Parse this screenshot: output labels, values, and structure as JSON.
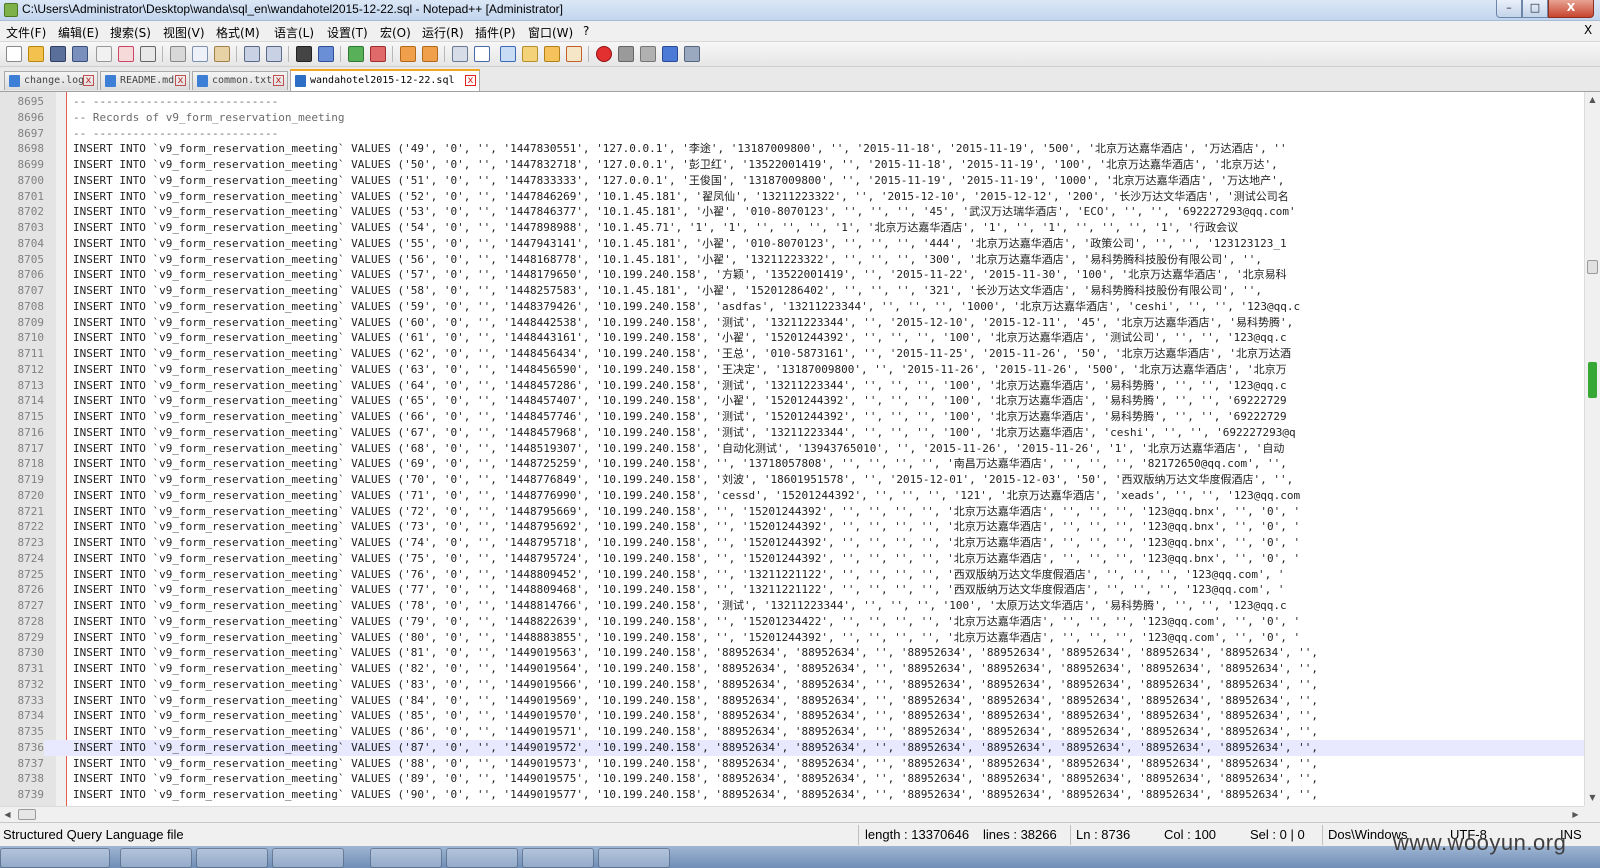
{
  "window": {
    "title": "C:\\Users\\Administrator\\Desktop\\wanda\\sql_en\\wandahotel2015-12-22.sql - Notepad++ [Administrator]",
    "min_label": "–",
    "max_label": "□",
    "close_label": "X"
  },
  "menu": {
    "items": [
      "文件(F)",
      "编辑(E)",
      "搜索(S)",
      "视图(V)",
      "格式(M)",
      "语言(L)",
      "设置(T)",
      "宏(O)",
      "运行(R)",
      "插件(P)",
      "窗口(W)",
      "?"
    ],
    "close_label": "X"
  },
  "tabs": [
    {
      "label": "change.log",
      "close": "x",
      "active": false
    },
    {
      "label": "README.md",
      "close": "x",
      "active": false
    },
    {
      "label": "common.txt",
      "close": "x",
      "active": false
    },
    {
      "label": "wandahotel2015-12-22.sql",
      "close": "x",
      "active": true
    }
  ],
  "editor": {
    "current_line": "8736",
    "lines": [
      {
        "n": "8695",
        "t": "-- ----------------------------"
      },
      {
        "n": "8696",
        "t": "-- Records of v9_form_reservation_meeting"
      },
      {
        "n": "8697",
        "t": "-- ----------------------------"
      },
      {
        "n": "8698",
        "t": "INSERT INTO `v9_form_reservation_meeting` VALUES ('49', '0', '', '1447830551', '127.0.0.1', '李途', '13187009800', '', '2015-11-18', '2015-11-19', '500', '北京万达嘉华酒店', '万达酒店', ''"
      },
      {
        "n": "8699",
        "t": "INSERT INTO `v9_form_reservation_meeting` VALUES ('50', '0', '', '1447832718', '127.0.0.1', '彭卫红', '13522001419', '', '2015-11-18', '2015-11-19', '100', '北京万达嘉华酒店', '北京万达',"
      },
      {
        "n": "8700",
        "t": "INSERT INTO `v9_form_reservation_meeting` VALUES ('51', '0', '', '1447833333', '127.0.0.1', '王俊国', '13187009800', '', '2015-11-19', '2015-11-19', '1000', '北京万达嘉华酒店', '万达地产',"
      },
      {
        "n": "8701",
        "t": "INSERT INTO `v9_form_reservation_meeting` VALUES ('52', '0', '', '1447846269', '10.1.45.181', '翟凤仙', '13211223322', '', '2015-12-10', '2015-12-12', '200', '长沙万达文华酒店', '测试公司名"
      },
      {
        "n": "8702",
        "t": "INSERT INTO `v9_form_reservation_meeting` VALUES ('53', '0', '', '1447846377', '10.1.45.181', '小翟', '010-8070123', '', '', '', '45', '武汉万达瑞华酒店', 'ECO', '', '', '692227293@qq.com'"
      },
      {
        "n": "8703",
        "t": "INSERT INTO `v9_form_reservation_meeting` VALUES ('54', '0', '', '1447898988', '10.1.45.71', '1', '1', '', '', '', '1', '北京万达嘉华酒店', '1', '', '1', '', '', '', '1', '行政会议"
      },
      {
        "n": "8704",
        "t": "INSERT INTO `v9_form_reservation_meeting` VALUES ('55', '0', '', '1447943141', '10.1.45.181', '小翟', '010-8070123', '', '', '', '444', '北京万达嘉华酒店', '政策公司', '', '', '123123123_1"
      },
      {
        "n": "8705",
        "t": "INSERT INTO `v9_form_reservation_meeting` VALUES ('56', '0', '', '1448168778', '10.1.45.181', '小翟', '13211223322', '', '', '', '300', '北京万达嘉华酒店', '易科势腾科技股份有限公司', '',"
      },
      {
        "n": "8706",
        "t": "INSERT INTO `v9_form_reservation_meeting` VALUES ('57', '0', '', '1448179650', '10.199.240.158', '方颖', '13522001419', '', '2015-11-22', '2015-11-30', '100', '北京万达嘉华酒店', '北京易科"
      },
      {
        "n": "8707",
        "t": "INSERT INTO `v9_form_reservation_meeting` VALUES ('58', '0', '', '1448257583', '10.1.45.181', '小翟', '15201286402', '', '', '', '321', '长沙万达文华酒店', '易科势腾科技股份有限公司', '',"
      },
      {
        "n": "8708",
        "t": "INSERT INTO `v9_form_reservation_meeting` VALUES ('59', '0', '', '1448379426', '10.199.240.158', 'asdfas', '13211223344', '', '', '', '1000', '北京万达嘉华酒店', 'ceshi', '', '', '123@qq.c"
      },
      {
        "n": "8709",
        "t": "INSERT INTO `v9_form_reservation_meeting` VALUES ('60', '0', '', '1448442538', '10.199.240.158', '测试', '13211223344', '', '2015-12-10', '2015-12-11', '45', '北京万达嘉华酒店', '易科势腾',"
      },
      {
        "n": "8710",
        "t": "INSERT INTO `v9_form_reservation_meeting` VALUES ('61', '0', '', '1448443161', '10.199.240.158', '小翟', '15201244392', '', '', '', '100', '北京万达嘉华酒店', '测试公司', '', '', '123@qq.c"
      },
      {
        "n": "8711",
        "t": "INSERT INTO `v9_form_reservation_meeting` VALUES ('62', '0', '', '1448456434', '10.199.240.158', '王总', '010-5873161', '', '2015-11-25', '2015-11-26', '50', '北京万达嘉华酒店', '北京万达酒"
      },
      {
        "n": "8712",
        "t": "INSERT INTO `v9_form_reservation_meeting` VALUES ('63', '0', '', '1448456590', '10.199.240.158', '王决定', '13187009800', '', '2015-11-26', '2015-11-26', '500', '北京万达嘉华酒店', '北京万"
      },
      {
        "n": "8713",
        "t": "INSERT INTO `v9_form_reservation_meeting` VALUES ('64', '0', '', '1448457286', '10.199.240.158', '测试', '13211223344', '', '', '', '100', '北京万达嘉华酒店', '易科势腾', '', '', '123@qq.c"
      },
      {
        "n": "8714",
        "t": "INSERT INTO `v9_form_reservation_meeting` VALUES ('65', '0', '', '1448457407', '10.199.240.158', '小翟', '15201244392', '', '', '', '100', '北京万达嘉华酒店', '易科势腾', '', '', '69222729"
      },
      {
        "n": "8715",
        "t": "INSERT INTO `v9_form_reservation_meeting` VALUES ('66', '0', '', '1448457746', '10.199.240.158', '测试', '15201244392', '', '', '', '100', '北京万达嘉华酒店', '易科势腾', '', '', '69222729"
      },
      {
        "n": "8716",
        "t": "INSERT INTO `v9_form_reservation_meeting` VALUES ('67', '0', '', '1448457968', '10.199.240.158', '测试', '13211223344', '', '', '', '100', '北京万达嘉华酒店', 'ceshi', '', '', '692227293@q"
      },
      {
        "n": "8717",
        "t": "INSERT INTO `v9_form_reservation_meeting` VALUES ('68', '0', '', '1448519307', '10.199.240.158', '自动化测试', '13943765010', '', '2015-11-26', '2015-11-26', '1', '北京万达嘉华酒店', '自动"
      },
      {
        "n": "8718",
        "t": "INSERT INTO `v9_form_reservation_meeting` VALUES ('69', '0', '', '1448725259', '10.199.240.158', '', '13718057808', '', '', '', '', '南昌万达嘉华酒店', '', '', '', '82172650@qq.com', '',"
      },
      {
        "n": "8719",
        "t": "INSERT INTO `v9_form_reservation_meeting` VALUES ('70', '0', '', '1448776849', '10.199.240.158', '刘波', '18601951578', '', '2015-12-01', '2015-12-03', '50', '西双版纳万达文华度假酒店', '',"
      },
      {
        "n": "8720",
        "t": "INSERT INTO `v9_form_reservation_meeting` VALUES ('71', '0', '', '1448776990', '10.199.240.158', 'cessd', '15201244392', '', '', '', '121', '北京万达嘉华酒店', 'xeads', '', '', '123@qq.com"
      },
      {
        "n": "8721",
        "t": "INSERT INTO `v9_form_reservation_meeting` VALUES ('72', '0', '', '1448795669', '10.199.240.158', '', '15201244392', '', '', '', '', '北京万达嘉华酒店', '', '', '', '123@qq.bnx', '', '0', '"
      },
      {
        "n": "8722",
        "t": "INSERT INTO `v9_form_reservation_meeting` VALUES ('73', '0', '', '1448795692', '10.199.240.158', '', '15201244392', '', '', '', '', '北京万达嘉华酒店', '', '', '', '123@qq.bnx', '', '0', '"
      },
      {
        "n": "8723",
        "t": "INSERT INTO `v9_form_reservation_meeting` VALUES ('74', '0', '', '1448795718', '10.199.240.158', '', '15201244392', '', '', '', '', '北京万达嘉华酒店', '', '', '', '123@qq.bnx', '', '0', '"
      },
      {
        "n": "8724",
        "t": "INSERT INTO `v9_form_reservation_meeting` VALUES ('75', '0', '', '1448795724', '10.199.240.158', '', '15201244392', '', '', '', '', '北京万达嘉华酒店', '', '', '', '123@qq.bnx', '', '0', '"
      },
      {
        "n": "8725",
        "t": "INSERT INTO `v9_form_reservation_meeting` VALUES ('76', '0', '', '1448809452', '10.199.240.158', '', '13211221122', '', '', '', '', '西双版纳万达文华度假酒店', '', '', '', '123@qq.com', '"
      },
      {
        "n": "8726",
        "t": "INSERT INTO `v9_form_reservation_meeting` VALUES ('77', '0', '', '1448809468', '10.199.240.158', '', '13211221122', '', '', '', '', '西双版纳万达文华度假酒店', '', '', '', '123@qq.com', '"
      },
      {
        "n": "8727",
        "t": "INSERT INTO `v9_form_reservation_meeting` VALUES ('78', '0', '', '1448814766', '10.199.240.158', '测试', '13211223344', '', '', '', '100', '太原万达文华酒店', '易科势腾', '', '', '123@qq.c"
      },
      {
        "n": "8728",
        "t": "INSERT INTO `v9_form_reservation_meeting` VALUES ('79', '0', '', '1448822639', '10.199.240.158', '', '15201234422', '', '', '', '', '北京万达嘉华酒店', '', '', '', '123@qq.com', '', '0', '"
      },
      {
        "n": "8729",
        "t": "INSERT INTO `v9_form_reservation_meeting` VALUES ('80', '0', '', '1448883855', '10.199.240.158', '', '15201244392', '', '', '', '', '北京万达嘉华酒店', '', '', '', '123@qq.com', '', '0', '"
      },
      {
        "n": "8730",
        "t": "INSERT INTO `v9_form_reservation_meeting` VALUES ('81', '0', '', '1449019563', '10.199.240.158', '88952634', '88952634', '', '88952634', '88952634', '88952634', '88952634', '88952634', '',"
      },
      {
        "n": "8731",
        "t": "INSERT INTO `v9_form_reservation_meeting` VALUES ('82', '0', '', '1449019564', '10.199.240.158', '88952634', '88952634', '', '88952634', '88952634', '88952634', '88952634', '88952634', '',"
      },
      {
        "n": "8732",
        "t": "INSERT INTO `v9_form_reservation_meeting` VALUES ('83', '0', '', '1449019566', '10.199.240.158', '88952634', '88952634', '', '88952634', '88952634', '88952634', '88952634', '88952634', '',"
      },
      {
        "n": "8733",
        "t": "INSERT INTO `v9_form_reservation_meeting` VALUES ('84', '0', '', '1449019569', '10.199.240.158', '88952634', '88952634', '', '88952634', '88952634', '88952634', '88952634', '88952634', '',"
      },
      {
        "n": "8734",
        "t": "INSERT INTO `v9_form_reservation_meeting` VALUES ('85', '0', '', '1449019570', '10.199.240.158', '88952634', '88952634', '', '88952634', '88952634', '88952634', '88952634', '88952634', '',"
      },
      {
        "n": "8735",
        "t": "INSERT INTO `v9_form_reservation_meeting` VALUES ('86', '0', '', '1449019571', '10.199.240.158', '88952634', '88952634', '', '88952634', '88952634', '88952634', '88952634', '88952634', '',"
      },
      {
        "n": "8736",
        "t": "INSERT INTO `v9_form_reservation_meeting` VALUES ('87', '0', '', '1449019572', '10.199.240.158', '88952634', '88952634', '', '88952634', '88952634', '88952634', '88952634', '88952634', '',"
      },
      {
        "n": "8737",
        "t": "INSERT INTO `v9_form_reservation_meeting` VALUES ('88', '0', '', '1449019573', '10.199.240.158', '88952634', '88952634', '', '88952634', '88952634', '88952634', '88952634', '88952634', '',"
      },
      {
        "n": "8738",
        "t": "INSERT INTO `v9_form_reservation_meeting` VALUES ('89', '0', '', '1449019575', '10.199.240.158', '88952634', '88952634', '', '88952634', '88952634', '88952634', '88952634', '88952634', '',"
      },
      {
        "n": "8739",
        "t": "INSERT INTO `v9_form_reservation_meeting` VALUES ('90', '0', '', '1449019577', '10.199.240.158', '88952634', '88952634', '', '88952634', '88952634', '88952634', '88952634', '88952634', '',"
      }
    ]
  },
  "status": {
    "file_type": "Structured Query Language file",
    "length": "length : 13370646",
    "lines": "lines : 38266",
    "ln": "Ln : 8736",
    "col": "Col : 100",
    "sel": "Sel : 0 | 0",
    "eol": "Dos\\Windows",
    "encoding": "UTF-8",
    "mode": "INS"
  },
  "watermark": "www.wooyun.org",
  "colors": {
    "edge_line": "#e06050",
    "current_line_bg": "#e8e8ff",
    "active_tab_accent": "#f5a623"
  }
}
